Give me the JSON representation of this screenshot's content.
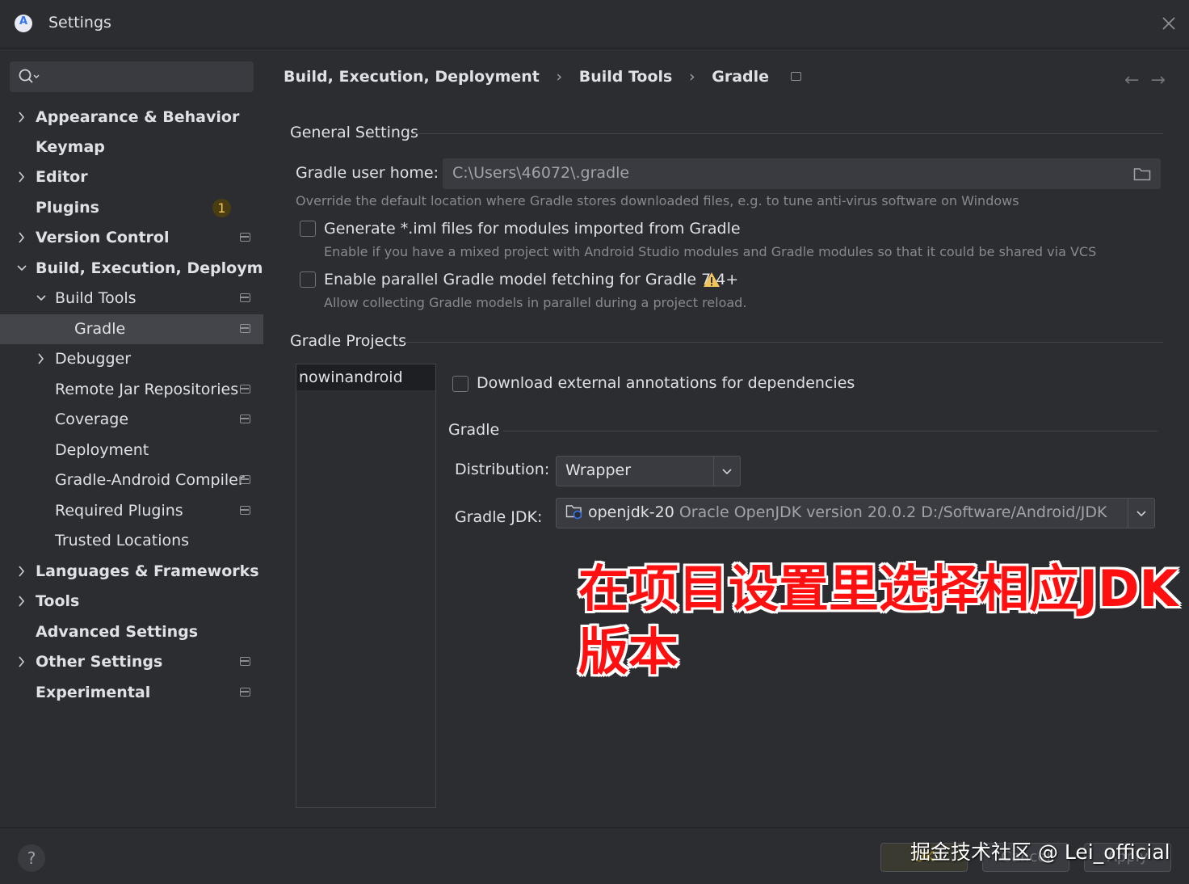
{
  "window": {
    "title": "Settings",
    "icons": [
      "app-logo-icon",
      "close-icon"
    ]
  },
  "sidebar": {
    "search_icon": "search-icon",
    "items": [
      {
        "label": "Appearance & Behavior",
        "expandable": true,
        "expanded": false
      },
      {
        "label": "Keymap"
      },
      {
        "label": "Editor",
        "expandable": true,
        "expanded": false
      },
      {
        "label": "Plugins",
        "badge": "1"
      },
      {
        "label": "Version Control",
        "expandable": true,
        "expanded": false,
        "project_icon": true
      },
      {
        "label": "Build, Execution, Deployment",
        "expandable": true,
        "expanded": true
      },
      {
        "label": "Build Tools",
        "expandable": true,
        "expanded": true,
        "project_icon": true
      },
      {
        "label": "Gradle",
        "selected": true,
        "project_icon": true
      },
      {
        "label": "Debugger",
        "expandable": true,
        "expanded": false
      },
      {
        "label": "Remote Jar Repositories",
        "project_icon": true
      },
      {
        "label": "Coverage",
        "project_icon": true
      },
      {
        "label": "Deployment"
      },
      {
        "label": "Gradle-Android Compiler",
        "project_icon": true
      },
      {
        "label": "Required Plugins",
        "project_icon": true
      },
      {
        "label": "Trusted Locations"
      },
      {
        "label": "Languages & Frameworks",
        "expandable": true,
        "expanded": false
      },
      {
        "label": "Tools",
        "expandable": true,
        "expanded": false
      },
      {
        "label": "Advanced Settings"
      },
      {
        "label": "Other Settings",
        "expandable": true,
        "expanded": false,
        "project_icon": true
      },
      {
        "label": "Experimental",
        "project_icon": true
      }
    ]
  },
  "breadcrumb": {
    "items": [
      "Build, Execution, Deployment",
      "Build Tools",
      "Gradle"
    ],
    "separator": "›",
    "back": "←",
    "forward": "→"
  },
  "general": {
    "title": "General Settings",
    "user_home_label": "Gradle user home:",
    "user_home_value": "C:\\Users\\46072\\.gradle",
    "user_home_hint": "Override the default location where Gradle stores downloaded files, e.g. to tune anti-virus software on Windows",
    "iml_label": "Generate *.iml files for modules imported from Gradle",
    "iml_checked": false,
    "iml_hint": "Enable if you have a mixed project with Android Studio modules and Gradle modules so that it could be shared via VCS",
    "parallel_label": "Enable parallel Gradle model fetching for Gradle 7.4+",
    "parallel_checked": false,
    "parallel_hint": "Allow collecting Gradle models in parallel during a project reload."
  },
  "projects": {
    "title": "Gradle Projects",
    "list": [
      "nowinandroid"
    ],
    "annotations_label": "Download external annotations for dependencies",
    "annotations_checked": false,
    "gradle_title": "Gradle",
    "distribution_label": "Distribution:",
    "distribution_value": "Wrapper",
    "jdk_label": "Gradle JDK:",
    "jdk_name": "openjdk-20",
    "jdk_detail": "Oracle OpenJDK version 20.0.2 D:/Software/Android/JDK"
  },
  "overlay": {
    "line1": "在项目设置里选择相应JDK",
    "line2": "版本"
  },
  "footer": {
    "help": "?",
    "ok": "OK",
    "cancel": "Cancel",
    "apply": "Apply",
    "watermark": "掘金技术社区 @ Lei_official"
  },
  "colors": {
    "background": "#2b2d30",
    "selection": "#43454a",
    "field": "#393b40",
    "overlay_text": "#ff1010",
    "badge": "#f2c55c",
    "warning": "#f2c55c"
  }
}
